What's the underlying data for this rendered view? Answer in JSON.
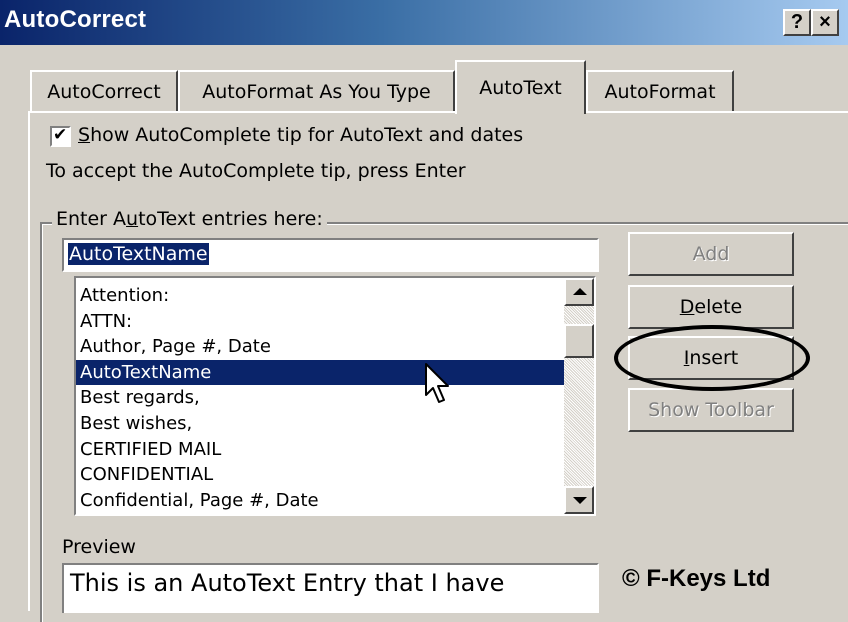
{
  "window": {
    "title": "AutoCorrect",
    "help_label": "?",
    "close_label": "×"
  },
  "tabs": [
    {
      "label": "AutoCorrect"
    },
    {
      "label": "AutoFormat As You Type"
    },
    {
      "label": "AutoText",
      "active": true
    },
    {
      "label": "AutoFormat"
    }
  ],
  "autocomplete": {
    "checked": true,
    "check_mark": "✔",
    "label_access_key": "S",
    "label_rest": "how AutoComplete tip for AutoText and dates",
    "hint": "To accept the AutoComplete tip, press Enter"
  },
  "entries": {
    "group_label_pre": "Enter A",
    "group_label_key": "u",
    "group_label_post": "toText entries here:",
    "name_value": "AutoTextName",
    "items": [
      {
        "label": "Attention:"
      },
      {
        "label": "ATTN:"
      },
      {
        "label": "Author, Page #, Date"
      },
      {
        "label": "AutoTextName",
        "selected": true
      },
      {
        "label": "Best regards,"
      },
      {
        "label": "Best wishes,"
      },
      {
        "label": "CERTIFIED MAIL"
      },
      {
        "label": "CONFIDENTIAL"
      },
      {
        "label": "Confidential, Page #, Date"
      }
    ]
  },
  "buttons": {
    "add": "Add",
    "delete_key": "D",
    "delete_rest": "elete",
    "insert_key": "I",
    "insert_rest": "nsert",
    "show_toolbar": "Show Toolbar"
  },
  "preview": {
    "label": "Preview",
    "text": "This is an AutoText Entry that I have"
  },
  "copyright": "© F-Keys Ltd",
  "colors": {
    "selection": "#0a246a",
    "titlebar_start": "#0a246a",
    "titlebar_end": "#a6caf0",
    "dialog_face": "#d4d0c8"
  }
}
